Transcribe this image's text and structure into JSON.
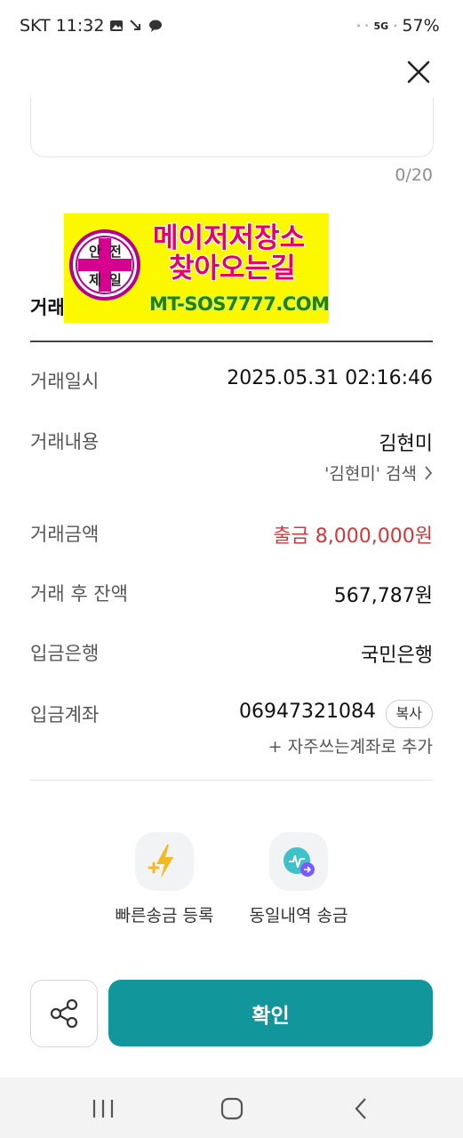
{
  "status_bar": {
    "carrier_time": "SKT 11:32",
    "battery": "57%",
    "network": "5G"
  },
  "memo": {
    "count": "0/20"
  },
  "ad": {
    "seal_top": "안 전",
    "seal_bottom": "제 일",
    "line1": "메이저저장소",
    "line2": "찾아오는길",
    "url": "MT-SOS7777.COM"
  },
  "section": {
    "title": "거래"
  },
  "rows": [
    {
      "label": "거래일시",
      "value": "2025.05.31 02:16:46"
    },
    {
      "label": "거래내용",
      "value": "김현미",
      "sub": "'김현미' 검색"
    },
    {
      "label": "거래금액",
      "value": "출금 8,000,000원"
    },
    {
      "label": "거래 후 잔액",
      "value": "567,787원"
    },
    {
      "label": "입금은행",
      "value": "국민은행"
    },
    {
      "label": "입금계좌",
      "value": "06947321084",
      "copy": "복사",
      "sub": "+ 자주쓰는계좌로 추가"
    }
  ],
  "actions": [
    {
      "label": "빠른송금 등록",
      "icon": "lightning-plus-icon"
    },
    {
      "label": "동일내역 송금",
      "icon": "repeat-transfer-icon"
    }
  ],
  "buttons": {
    "confirm": "확인"
  },
  "colors": {
    "accent": "#10969b",
    "withdraw_red": "#d2383b"
  }
}
